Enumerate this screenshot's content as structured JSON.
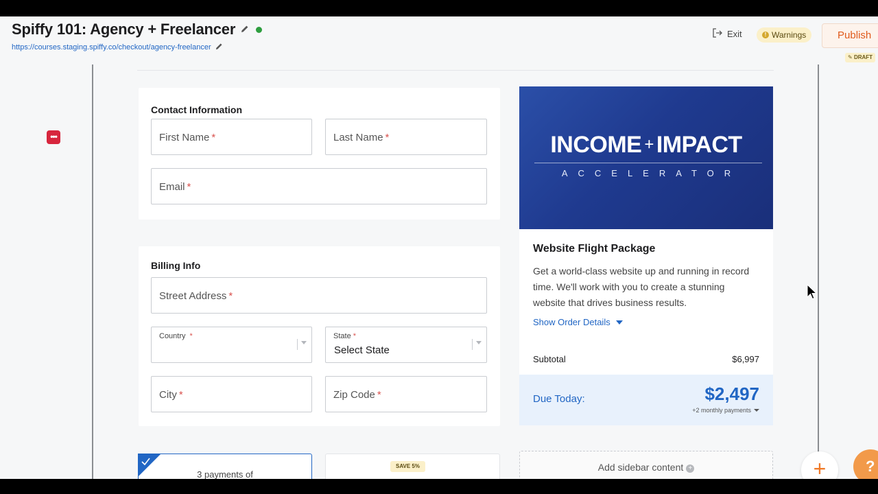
{
  "header": {
    "title": "Spiffy 101: Agency + Freelancer",
    "url": "https://courses.staging.spiffy.co/checkout/agency-freelancer",
    "exit_label": "Exit",
    "warnings_label": "Warnings",
    "publish_label": "Publish",
    "draft_label": "DRAFT"
  },
  "contact": {
    "title": "Contact Information",
    "first_name": "First Name",
    "last_name": "Last Name",
    "email": "Email",
    "required_mark": "*"
  },
  "billing": {
    "title": "Billing Info",
    "street": "Street Address",
    "country": "Country",
    "state": "State",
    "state_value": "Select State",
    "city": "City",
    "zip": "Zip Code",
    "required_mark": "*"
  },
  "payment_options": [
    {
      "label": "3 payments of",
      "selected": true
    },
    {
      "badge": "SAVE 5%",
      "selected": false
    }
  ],
  "product": {
    "banner_title_left": "INCOME",
    "banner_plus": "+",
    "banner_title_right": "IMPACT",
    "banner_subtitle": "ACCELERATOR",
    "name": "Website Flight Package",
    "description": "Get a world-class website up and running in record time. We'll work with you to create a stunning website that drives business results.",
    "order_details_label": "Show Order Details",
    "subtotal_label": "Subtotal",
    "subtotal_value": "$6,997",
    "due_label": "Due Today:",
    "due_amount": "$2,497",
    "due_note": "+2 monthly payments"
  },
  "sidebar": {
    "add_content_label": "Add sidebar content"
  },
  "colors": {
    "accent": "#2166c4",
    "publish": "#e05a1b",
    "banner": "#1f3a8f",
    "required": "#d9534f"
  }
}
